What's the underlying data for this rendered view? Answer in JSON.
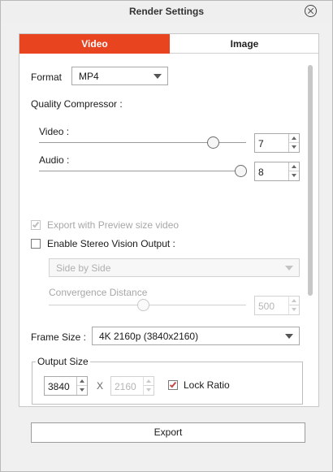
{
  "window": {
    "title": "Render Settings"
  },
  "tabs": [
    {
      "label": "Video",
      "active": true
    },
    {
      "label": "Image",
      "active": false
    }
  ],
  "format": {
    "label": "Format",
    "value": "MP4"
  },
  "quality": {
    "label": "Quality Compressor :",
    "video": {
      "label": "Video :",
      "value": "7",
      "slider_level": 0.85
    },
    "audio": {
      "label": "Audio :",
      "value": "8",
      "slider_level": 1.0
    }
  },
  "preview_export": {
    "label": "Export with Preview size video",
    "checked": true,
    "enabled": false
  },
  "stereo": {
    "label": "Enable Stereo Vision Output :",
    "checked": false,
    "mode": "Side by Side",
    "convergence": {
      "label": "Convergence Distance",
      "value": "500"
    }
  },
  "frame_size": {
    "label": "Frame Size :",
    "value": "4K 2160p (3840x2160)"
  },
  "output_size": {
    "label": "Output Size",
    "width": "3840",
    "separator": "X",
    "height": "2160",
    "lock_ratio": {
      "label": "Lock Ratio",
      "checked": true
    }
  },
  "export_button": {
    "label": "Export"
  },
  "colors": {
    "accent": "#e8441f",
    "check": "#c64a4a"
  }
}
